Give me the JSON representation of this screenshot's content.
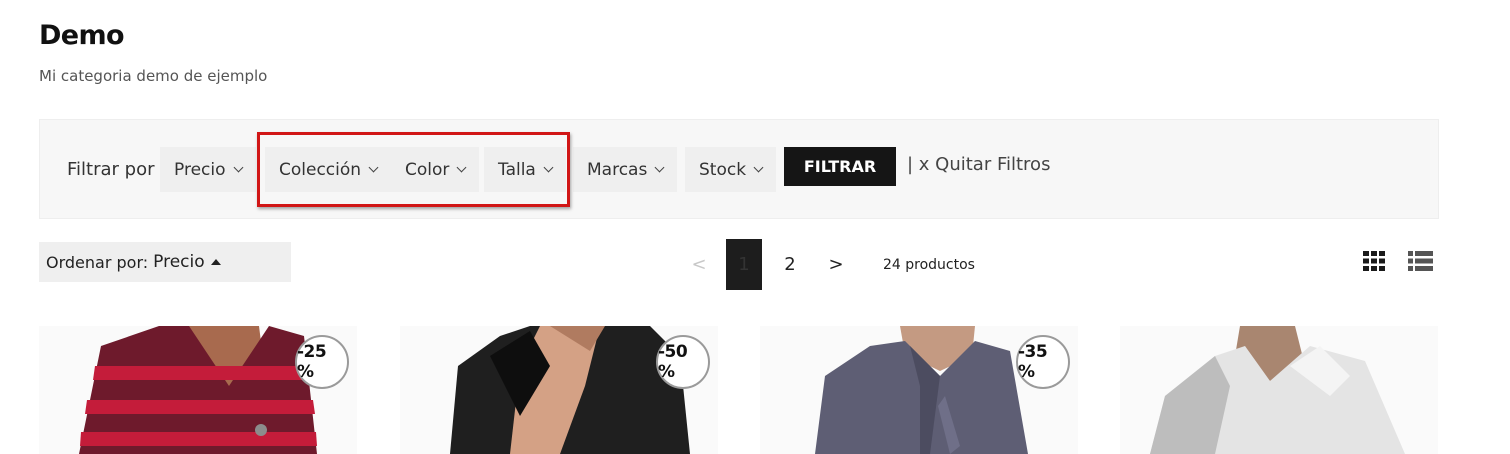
{
  "page": {
    "title": "Demo",
    "subtitle": "Mi categoria demo de ejemplo"
  },
  "filters": {
    "label": "Filtrar por",
    "dropdowns": [
      "Precio",
      "Colección",
      "Color",
      "Talla",
      "Marcas",
      "Stock"
    ],
    "apply_label": "FILTRAR",
    "clear_label": "| x Quitar Filtros"
  },
  "sort": {
    "label": "Ordenar por:",
    "value": "Precio"
  },
  "pagination": {
    "prev": "<",
    "pages": [
      "1",
      "2"
    ],
    "current": "1",
    "next": ">",
    "count_text": "24 productos"
  },
  "products": [
    {
      "discount": "-25 %",
      "shirt_color": "#6e1a2c",
      "stripe_color": "#c41c3a"
    },
    {
      "discount": "-50 %",
      "shirt_color": "#1f1f1f"
    },
    {
      "discount": "-35 %",
      "shirt_color": "#5e5e74"
    },
    {
      "discount": "",
      "shirt_color": "#e4e4e4"
    }
  ],
  "colors": {
    "highlight": "#d11616",
    "button_bg": "#151515",
    "filter_bar_bg": "#f7f7f7"
  },
  "icons": [
    "chevron-down-icon",
    "sort-asc-icon",
    "grid-view-icon",
    "list-view-icon"
  ]
}
